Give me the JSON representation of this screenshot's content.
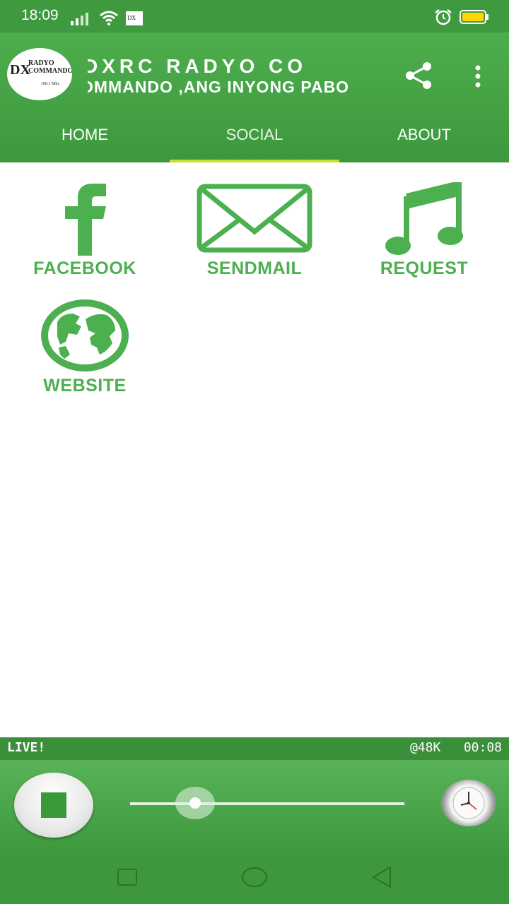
{
  "status_bar": {
    "time": "18:09",
    "colors": {
      "background": "#3f9a3f",
      "battery_fill": "#ffd600"
    },
    "icons": [
      "signal-icon",
      "wifi-icon",
      "radio-commando-notification-icon",
      "alarm-icon",
      "battery-icon"
    ]
  },
  "app_bar": {
    "logo": {
      "line1": "DX",
      "line2a": "RADYO",
      "line2b": "COMMANDO",
      "line3": "100.1 Mhz"
    },
    "marquee_line1": "DXRC RADYO CO",
    "marquee_line2": "OMMANDO ,ANG INYONG PABO",
    "icons": [
      "share-icon",
      "more-vert-icon"
    ]
  },
  "tabs": [
    {
      "label": "HOME",
      "active": false
    },
    {
      "label": "SOCIAL",
      "active": true
    },
    {
      "label": "ABOUT",
      "active": false
    }
  ],
  "social": {
    "items": [
      {
        "label": "FACEBOOK",
        "icon": "facebook-icon"
      },
      {
        "label": "SENDMAIL",
        "icon": "envelope-icon"
      },
      {
        "label": "REQUEST",
        "icon": "music-note-icon"
      },
      {
        "label": "WEBSITE",
        "icon": "globe-icon"
      }
    ]
  },
  "player": {
    "live_label": "LIVE!",
    "bitrate": "@48K",
    "elapsed": "00:08",
    "volume_level": 0.19,
    "icons": [
      "stop-icon",
      "clock-icon"
    ]
  },
  "nav_bar": {
    "icons": [
      "recents-icon",
      "home-icon",
      "back-icon"
    ]
  },
  "colors": {
    "brand_green": "#4caf50",
    "app_bar": "#46a546",
    "tab_indicator": "#c6df2e"
  }
}
